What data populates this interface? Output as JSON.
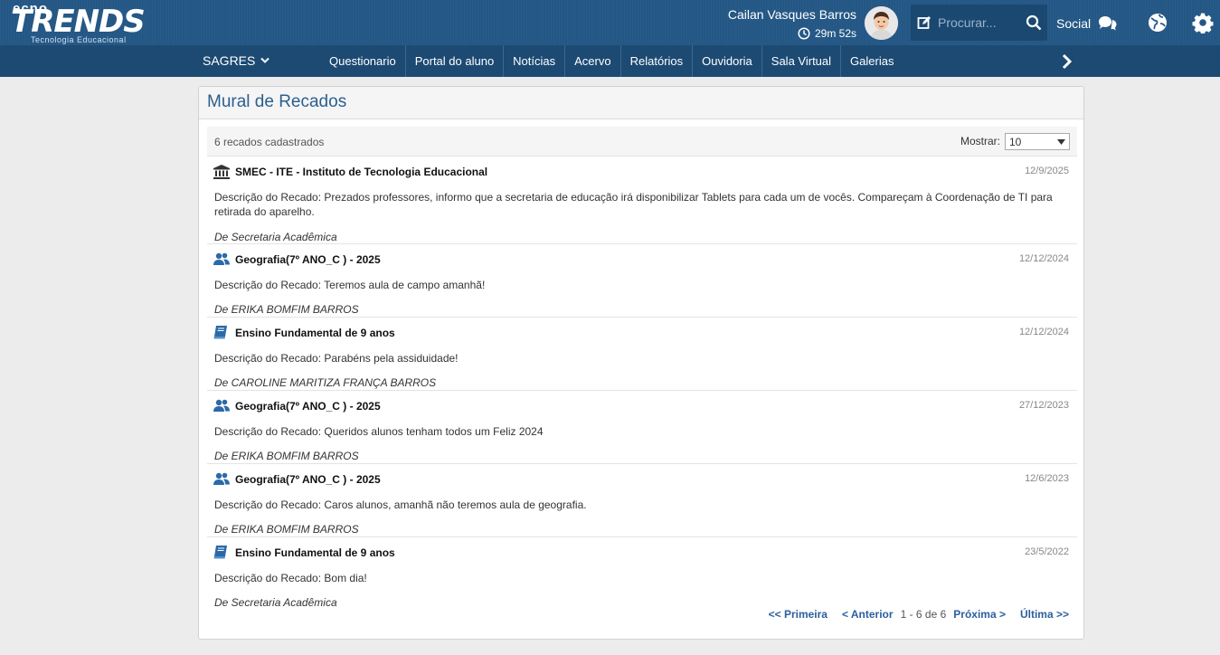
{
  "header": {
    "logo_top": "ecno",
    "logo_main": "TRENDS",
    "logo_sub": "Tecnologia Educacional",
    "user_name": "Cailan Vasques Barros",
    "session_timer": "29m 52s",
    "search_placeholder": "Procurar...",
    "social_label": "Social"
  },
  "nav": {
    "brand": "SAGRES",
    "items": [
      "Questionario",
      "Portal do aluno",
      "Notícias",
      "Acervo",
      "Relatórios",
      "Ouvidoria",
      "Sala Virtual",
      "Galerias"
    ]
  },
  "panel": {
    "title": "Mural de Recados",
    "count_text": "6 recados cadastrados",
    "show_label": "Mostrar:",
    "show_value": "10"
  },
  "messages": [
    {
      "icon": "institution-icon",
      "title": "SMEC - ITE - Instituto de Tecnologia Educacional",
      "date": "12/9/2025",
      "description": "Descrição do Recado: Prezados professores, informo que a secretaria de educação irá disponibilizar Tablets para cada um de vocês. Compareçam à Coordenação de TI para retirada do aparelho.",
      "from": "De Secretaria Acadêmica"
    },
    {
      "icon": "users-icon",
      "title": "Geografia(7º ANO_C ) - 2025",
      "date": "12/12/2024",
      "description": "Descrição do Recado: Teremos aula de campo amanhã!",
      "from": "De ERIKA BOMFIM BARROS"
    },
    {
      "icon": "book-icon",
      "title": "Ensino Fundamental de 9 anos",
      "date": "12/12/2024",
      "description": "Descrição do Recado: Parabéns pela assiduidade!",
      "from": "De CAROLINE MARITIZA FRANÇA BARROS"
    },
    {
      "icon": "users-icon",
      "title": "Geografia(7º ANO_C ) - 2025",
      "date": "27/12/2023",
      "description": "Descrição do Recado: Queridos alunos tenham todos um Feliz 2024",
      "from": "De ERIKA BOMFIM BARROS"
    },
    {
      "icon": "users-icon",
      "title": "Geografia(7º ANO_C ) - 2025",
      "date": "12/6/2023",
      "description": "Descrição do Recado: Caros alunos, amanhã não teremos aula de geografia.",
      "from": "De ERIKA BOMFIM BARROS"
    },
    {
      "icon": "book-icon",
      "title": "Ensino Fundamental de 9 anos",
      "date": "23/5/2022",
      "description": "Descrição do Recado: Bom dia!",
      "from": "De Secretaria Acadêmica"
    }
  ],
  "pagination": {
    "first": "<< Primeira",
    "prev": "< Anterior",
    "info": "1 - 6 de 6",
    "next": "Próxima >",
    "last": "Última >>"
  },
  "colors": {
    "header_bg": "#245785",
    "nav_bg": "#1c4a72",
    "title_blue": "#2b5f8f",
    "icon_blue": "#2b6aa8"
  }
}
